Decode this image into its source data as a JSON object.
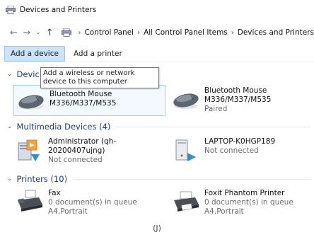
{
  "window": {
    "title": "Devices and Printers"
  },
  "address": {
    "crumbs": [
      "Control Panel",
      "All Control Panel Items",
      "Devices and Printers"
    ]
  },
  "toolbar": {
    "add_device": "Add a device",
    "add_printer": "Add a printer"
  },
  "tooltip": {
    "text": "Add a wireless or network device to this computer"
  },
  "sections": {
    "devices": {
      "header": "Devic"
    },
    "multimedia": {
      "header": "Multimedia Devices (4)"
    },
    "printers": {
      "header": "Printers (10)"
    }
  },
  "devices": [
    {
      "name": "Bluetooth Mouse",
      "name2": "M336/M337/M535",
      "status": ""
    },
    {
      "name": "Bluetooth Mouse",
      "name2": "M336/M337/M535",
      "status": "Paired"
    }
  ],
  "multimedia": [
    {
      "name": "Administrator (qh-20200407ujng)",
      "status": "Not connected"
    },
    {
      "name": "LAPTOP-K0HGP189",
      "status": "Not connected"
    }
  ],
  "printers": [
    {
      "name": "Fax",
      "line2": "0 document(s) in queue",
      "line3": "A4,Portrait"
    },
    {
      "name": "Foxit Phantom Printer",
      "line2": "0 document(s) in queue",
      "line3": "A4,Portrait"
    }
  ],
  "caption": "(J)",
  "colors": {
    "accent": "#1e3a8a",
    "selection": "#cce4f7",
    "link": "#1a73e8"
  },
  "icons": {
    "app": "printer-icon",
    "back": "back-arrow-icon",
    "forward": "forward-arrow-icon",
    "recent": "chevron-down-icon",
    "up": "up-arrow-icon"
  }
}
